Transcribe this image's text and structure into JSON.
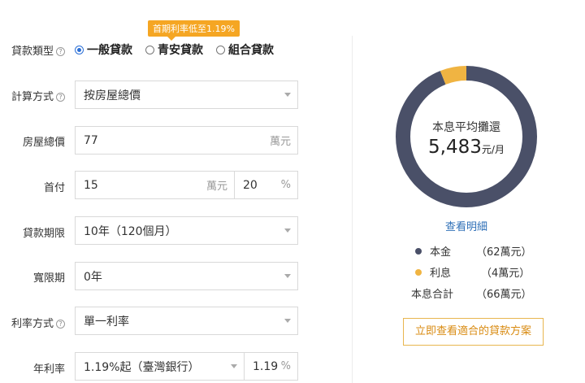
{
  "form": {
    "loan_type_label": "貸款類型",
    "loan_types": [
      "一般貸款",
      "青安貸款",
      "組合貸款"
    ],
    "promo_badge": "首期利率低至1.19%",
    "calc_method_label": "計算方式",
    "calc_method_value": "按房屋總價",
    "house_price_label": "房屋總價",
    "house_price_value": "77",
    "house_price_unit": "萬元",
    "down_payment_label": "首付",
    "down_payment_value": "15",
    "down_payment_unit": "萬元",
    "down_payment_pct": "20",
    "pct_unit": "%",
    "term_label": "貸款期限",
    "term_value": "10年（120個月）",
    "grace_label": "寬限期",
    "grace_value": "0年",
    "rate_type_label": "利率方式",
    "rate_type_value": "單一利率",
    "annual_rate_label": "年利率",
    "annual_rate_value": "1.19%起（臺灣銀行）",
    "annual_rate_input": "1.19"
  },
  "summary": {
    "center_label": "本息平均攤還",
    "monthly_amount": "5,483",
    "monthly_unit": "元/月",
    "detail_link": "查看明細",
    "principal_label": "本金",
    "principal_value": "（62萬元）",
    "interest_label": "利息",
    "interest_value": "（4萬元）",
    "total_label": "本息合計",
    "total_value": "（66萬元）",
    "cta": "立即查看適合的貸款方案"
  },
  "chart_data": {
    "type": "pie",
    "categories": [
      "本金",
      "利息"
    ],
    "values": [
      62,
      4
    ],
    "unit": "萬元"
  },
  "colors": {
    "principal": "#4a5068",
    "interest": "#f0b442",
    "accent_blue": "#2e6fb7",
    "promo": "#f5a623"
  }
}
